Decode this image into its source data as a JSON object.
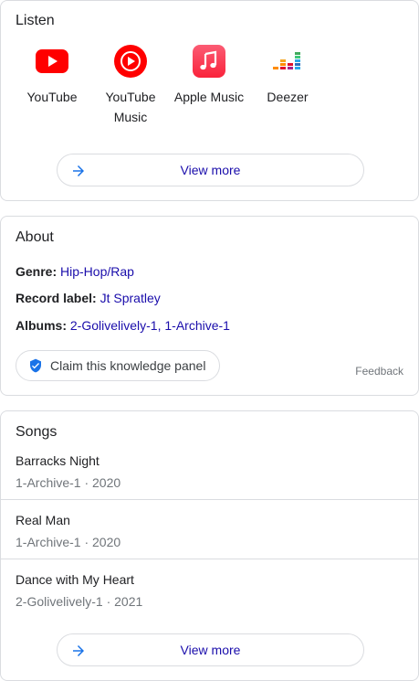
{
  "listen": {
    "title": "Listen",
    "providers": [
      {
        "label": "YouTube",
        "icon": "youtube-icon",
        "color": "#ff0000"
      },
      {
        "label": "YouTube Music",
        "icon": "youtube-music-icon",
        "color": "#ff0000"
      },
      {
        "label": "Apple Music",
        "icon": "apple-music-icon",
        "color": "#fa3e57"
      },
      {
        "label": "Deezer",
        "icon": "deezer-icon",
        "color": "#29a8ea"
      }
    ],
    "view_more": "View more"
  },
  "about": {
    "title": "About",
    "genre_key": "Genre:",
    "genre_value": "Hip-Hop/Rap",
    "label_key": "Record label:",
    "label_value": "Jt Spratley",
    "albums_key": "Albums:",
    "albums": [
      "2-Golivelively-1",
      "1-Archive-1"
    ],
    "album_separator": ", ",
    "claim": "Claim this knowledge panel",
    "feedback": "Feedback"
  },
  "songs": {
    "title": "Songs",
    "items": [
      {
        "name": "Barracks Night",
        "meta": "1-Archive-1 · 2020"
      },
      {
        "name": "Real Man",
        "meta": "1-Archive-1 · 2020"
      },
      {
        "name": "Dance with My Heart",
        "meta": "2-Golivelively-1 · 2021"
      }
    ],
    "view_more": "View more"
  },
  "colors": {
    "link": "#1a0dab",
    "accent_blue": "#1a73e8",
    "border": "#dadce0",
    "muted": "#70757a"
  }
}
